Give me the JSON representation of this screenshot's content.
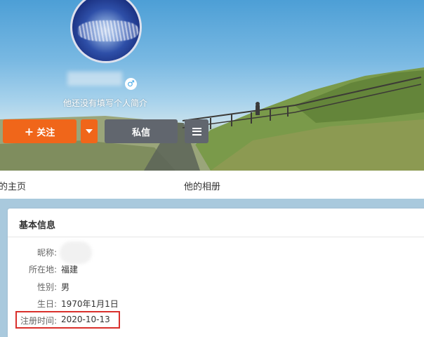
{
  "profile": {
    "bio": "他还没有填写个人简介",
    "gender_symbol": "♂"
  },
  "actions": {
    "follow_label": "关注",
    "follow_icon": "+",
    "message_label": "私信"
  },
  "nav": {
    "tabs": [
      {
        "label": "的主页"
      },
      {
        "label": "他的相册"
      }
    ]
  },
  "info": {
    "title": "基本信息",
    "rows": [
      {
        "label": "昵称:",
        "value": ""
      },
      {
        "label": "所在地:",
        "value": "福建"
      },
      {
        "label": "性别:",
        "value": "男"
      },
      {
        "label": "生日:",
        "value": "1970年1月1日"
      },
      {
        "label": "注册时间:",
        "value": "2020-10-13"
      }
    ]
  },
  "colors": {
    "follow_button": "#f0661a",
    "secondary_button": "#61666e",
    "highlight_border": "#d9302c",
    "gender_icon": "#3ea6e8"
  },
  "icons": {
    "follow": "plus-icon",
    "more": "caret-down-icon",
    "menu": "hamburger-menu-icon",
    "gender": "male-icon"
  }
}
